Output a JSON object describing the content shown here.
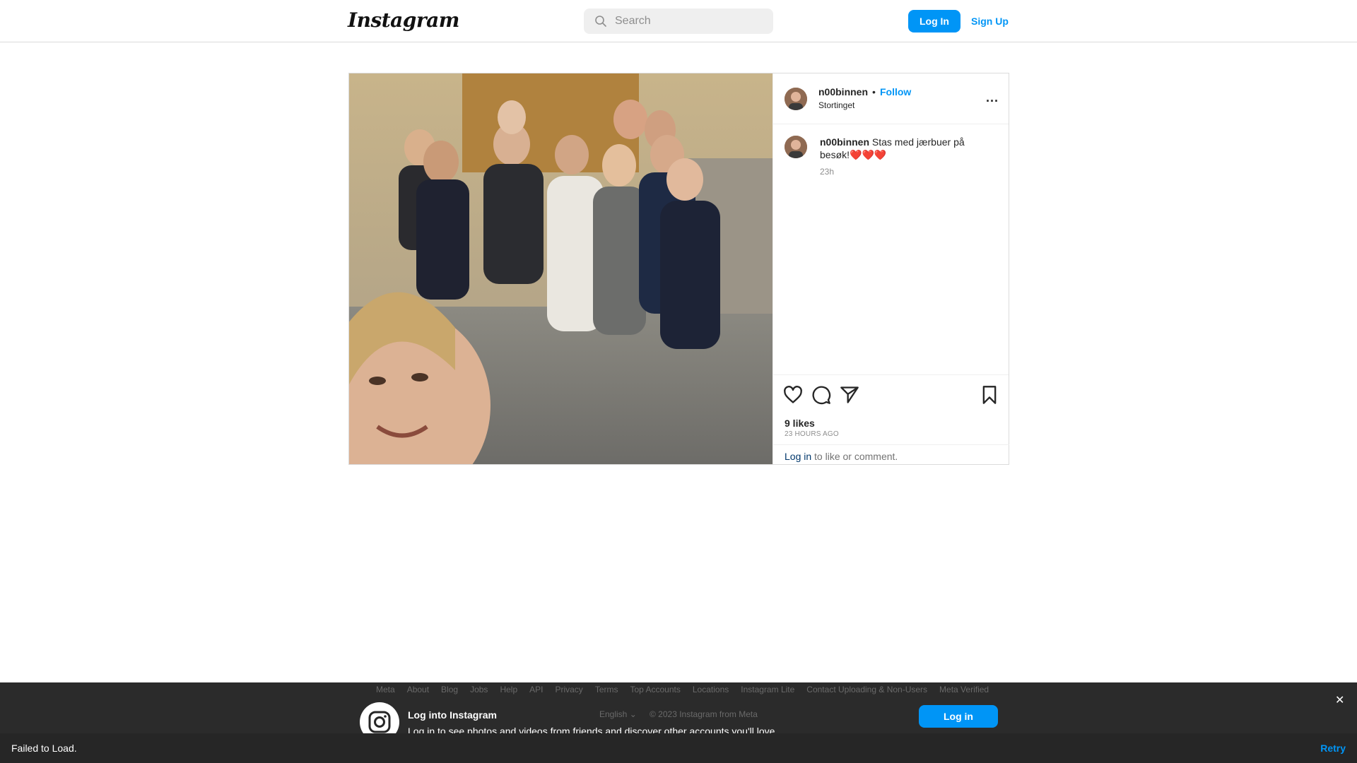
{
  "header": {
    "logo_text": "Instagram",
    "search_placeholder": "Search",
    "login_label": "Log In",
    "signup_label": "Sign Up"
  },
  "post": {
    "username": "n00binnen",
    "separator": "•",
    "follow_label": "Follow",
    "location": "Stortinget",
    "more_label": "...",
    "caption_text": "Stas med jærbuer på besøk!❤️❤️❤️",
    "caption_time": "23h",
    "likes": "9 likes",
    "time_ago": "23 HOURS AGO",
    "login_link": "Log in",
    "login_suffix": " to like or comment."
  },
  "footer": {
    "links": [
      "Meta",
      "About",
      "Blog",
      "Jobs",
      "Help",
      "API",
      "Privacy",
      "Terms",
      "Top Accounts",
      "Locations",
      "Instagram Lite",
      "Contact Uploading & Non-Users",
      "Meta Verified"
    ],
    "title": "Log into Instagram",
    "subtitle": "Log in to see photos and videos from friends and discover other accounts you'll love.",
    "language": "English ⌄",
    "copyright": "© 2023 Instagram from Meta",
    "login_label": "Log in",
    "close_label": "✕"
  },
  "toast": {
    "message": "Failed to Load.",
    "retry_label": "Retry"
  },
  "colors": {
    "accent": "#0095f6",
    "link_dark": "#00376b",
    "border": "#dbdbdb"
  },
  "icons": [
    "search-icon",
    "heart-icon",
    "comment-icon",
    "share-icon",
    "bookmark-icon",
    "more-icon",
    "instagram-glyph-icon",
    "close-icon"
  ]
}
